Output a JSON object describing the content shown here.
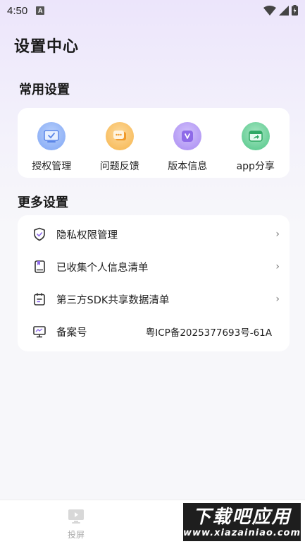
{
  "status_bar": {
    "time": "4:50",
    "notification_letter": "A"
  },
  "page": {
    "title": "设置中心"
  },
  "common_settings": {
    "title": "常用设置",
    "items": [
      {
        "label": "授权管理",
        "icon": "authorization-icon",
        "color": "#7fa6f5"
      },
      {
        "label": "问题反馈",
        "icon": "feedback-icon",
        "color": "#f7b54c"
      },
      {
        "label": "版本信息",
        "icon": "version-icon",
        "color": "#a98af2"
      },
      {
        "label": "app分享",
        "icon": "share-icon",
        "color": "#4fc686"
      }
    ]
  },
  "more_settings": {
    "title": "更多设置",
    "items": [
      {
        "label": "隐私权限管理",
        "icon": "shield-icon"
      },
      {
        "label": "已收集个人信息清单",
        "icon": "book-icon"
      },
      {
        "label": "第三方SDK共享数据清单",
        "icon": "calendar-list-icon"
      },
      {
        "label": "备案号",
        "icon": "monitor-icon",
        "value": "粤ICP备2025377693号-61A"
      }
    ]
  },
  "bottom_nav": {
    "cast_label": "投屏"
  },
  "watermark": {
    "title": "下载吧应用",
    "url": "www.xiazainiao.com"
  }
}
